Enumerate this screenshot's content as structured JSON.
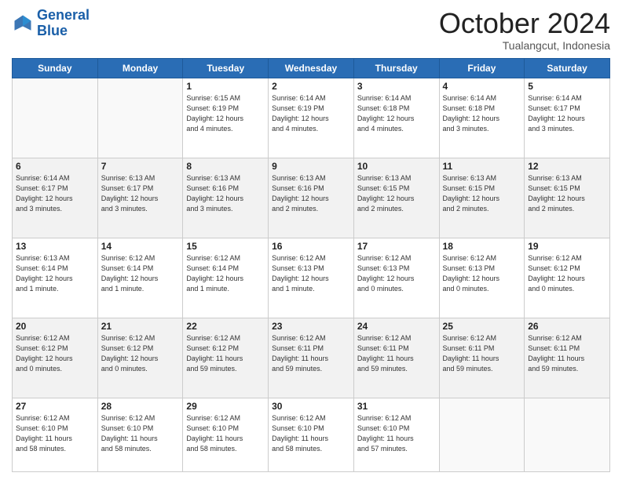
{
  "header": {
    "logo_line1": "General",
    "logo_line2": "Blue",
    "month": "October 2024",
    "location": "Tualangcut, Indonesia"
  },
  "days_of_week": [
    "Sunday",
    "Monday",
    "Tuesday",
    "Wednesday",
    "Thursday",
    "Friday",
    "Saturday"
  ],
  "weeks": [
    [
      {
        "day": "",
        "info": ""
      },
      {
        "day": "",
        "info": ""
      },
      {
        "day": "1",
        "info": "Sunrise: 6:15 AM\nSunset: 6:19 PM\nDaylight: 12 hours\nand 4 minutes."
      },
      {
        "day": "2",
        "info": "Sunrise: 6:14 AM\nSunset: 6:19 PM\nDaylight: 12 hours\nand 4 minutes."
      },
      {
        "day": "3",
        "info": "Sunrise: 6:14 AM\nSunset: 6:18 PM\nDaylight: 12 hours\nand 4 minutes."
      },
      {
        "day": "4",
        "info": "Sunrise: 6:14 AM\nSunset: 6:18 PM\nDaylight: 12 hours\nand 3 minutes."
      },
      {
        "day": "5",
        "info": "Sunrise: 6:14 AM\nSunset: 6:17 PM\nDaylight: 12 hours\nand 3 minutes."
      }
    ],
    [
      {
        "day": "6",
        "info": "Sunrise: 6:14 AM\nSunset: 6:17 PM\nDaylight: 12 hours\nand 3 minutes."
      },
      {
        "day": "7",
        "info": "Sunrise: 6:13 AM\nSunset: 6:17 PM\nDaylight: 12 hours\nand 3 minutes."
      },
      {
        "day": "8",
        "info": "Sunrise: 6:13 AM\nSunset: 6:16 PM\nDaylight: 12 hours\nand 3 minutes."
      },
      {
        "day": "9",
        "info": "Sunrise: 6:13 AM\nSunset: 6:16 PM\nDaylight: 12 hours\nand 2 minutes."
      },
      {
        "day": "10",
        "info": "Sunrise: 6:13 AM\nSunset: 6:15 PM\nDaylight: 12 hours\nand 2 minutes."
      },
      {
        "day": "11",
        "info": "Sunrise: 6:13 AM\nSunset: 6:15 PM\nDaylight: 12 hours\nand 2 minutes."
      },
      {
        "day": "12",
        "info": "Sunrise: 6:13 AM\nSunset: 6:15 PM\nDaylight: 12 hours\nand 2 minutes."
      }
    ],
    [
      {
        "day": "13",
        "info": "Sunrise: 6:13 AM\nSunset: 6:14 PM\nDaylight: 12 hours\nand 1 minute."
      },
      {
        "day": "14",
        "info": "Sunrise: 6:12 AM\nSunset: 6:14 PM\nDaylight: 12 hours\nand 1 minute."
      },
      {
        "day": "15",
        "info": "Sunrise: 6:12 AM\nSunset: 6:14 PM\nDaylight: 12 hours\nand 1 minute."
      },
      {
        "day": "16",
        "info": "Sunrise: 6:12 AM\nSunset: 6:13 PM\nDaylight: 12 hours\nand 1 minute."
      },
      {
        "day": "17",
        "info": "Sunrise: 6:12 AM\nSunset: 6:13 PM\nDaylight: 12 hours\nand 0 minutes."
      },
      {
        "day": "18",
        "info": "Sunrise: 6:12 AM\nSunset: 6:13 PM\nDaylight: 12 hours\nand 0 minutes."
      },
      {
        "day": "19",
        "info": "Sunrise: 6:12 AM\nSunset: 6:12 PM\nDaylight: 12 hours\nand 0 minutes."
      }
    ],
    [
      {
        "day": "20",
        "info": "Sunrise: 6:12 AM\nSunset: 6:12 PM\nDaylight: 12 hours\nand 0 minutes."
      },
      {
        "day": "21",
        "info": "Sunrise: 6:12 AM\nSunset: 6:12 PM\nDaylight: 12 hours\nand 0 minutes."
      },
      {
        "day": "22",
        "info": "Sunrise: 6:12 AM\nSunset: 6:12 PM\nDaylight: 11 hours\nand 59 minutes."
      },
      {
        "day": "23",
        "info": "Sunrise: 6:12 AM\nSunset: 6:11 PM\nDaylight: 11 hours\nand 59 minutes."
      },
      {
        "day": "24",
        "info": "Sunrise: 6:12 AM\nSunset: 6:11 PM\nDaylight: 11 hours\nand 59 minutes."
      },
      {
        "day": "25",
        "info": "Sunrise: 6:12 AM\nSunset: 6:11 PM\nDaylight: 11 hours\nand 59 minutes."
      },
      {
        "day": "26",
        "info": "Sunrise: 6:12 AM\nSunset: 6:11 PM\nDaylight: 11 hours\nand 59 minutes."
      }
    ],
    [
      {
        "day": "27",
        "info": "Sunrise: 6:12 AM\nSunset: 6:10 PM\nDaylight: 11 hours\nand 58 minutes."
      },
      {
        "day": "28",
        "info": "Sunrise: 6:12 AM\nSunset: 6:10 PM\nDaylight: 11 hours\nand 58 minutes."
      },
      {
        "day": "29",
        "info": "Sunrise: 6:12 AM\nSunset: 6:10 PM\nDaylight: 11 hours\nand 58 minutes."
      },
      {
        "day": "30",
        "info": "Sunrise: 6:12 AM\nSunset: 6:10 PM\nDaylight: 11 hours\nand 58 minutes."
      },
      {
        "day": "31",
        "info": "Sunrise: 6:12 AM\nSunset: 6:10 PM\nDaylight: 11 hours\nand 57 minutes."
      },
      {
        "day": "",
        "info": ""
      },
      {
        "day": "",
        "info": ""
      }
    ]
  ]
}
